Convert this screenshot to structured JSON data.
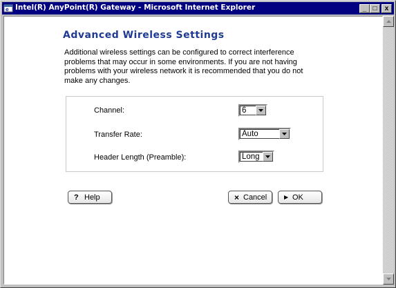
{
  "window": {
    "title": "Intel(R) AnyPoint(R) Gateway - Microsoft Internet Explorer",
    "controls": {
      "minimize": "_",
      "maximize": "□",
      "close": "x"
    }
  },
  "page": {
    "title": "Advanced Wireless Settings",
    "intro": "Additional wireless settings can be configured to correct interference problems that may occur in some environments. If you are not having problems with your wireless network it is recommended that you do not make any changes."
  },
  "settings": {
    "channel": {
      "label": "Channel:",
      "value": "6"
    },
    "transfer_rate": {
      "label": "Transfer Rate:",
      "value": "Auto"
    },
    "preamble": {
      "label": "Header Length (Preamble):",
      "value": "Long"
    }
  },
  "buttons": {
    "help": {
      "label": "Help",
      "icon": "question-icon"
    },
    "cancel": {
      "label": "Cancel",
      "icon": "x-icon"
    },
    "ok": {
      "label": "OK",
      "icon": "play-arrow-icon"
    }
  },
  "colors": {
    "title_bar": "#000080",
    "heading": "#1f3a93",
    "window_chrome": "#c0c0c0"
  }
}
